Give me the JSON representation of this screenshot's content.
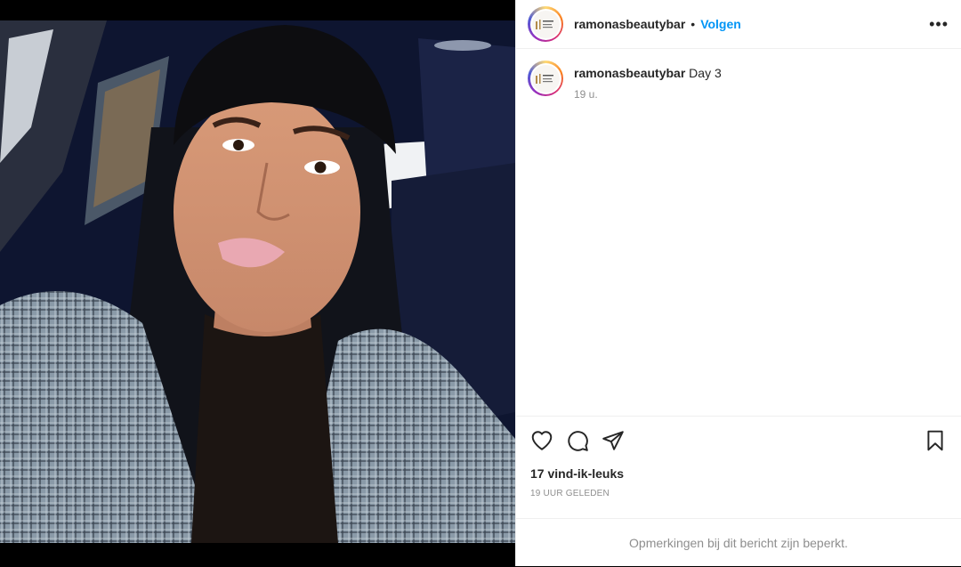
{
  "post": {
    "username": "ramonasbeautybar",
    "separator": "•",
    "follow_label": "Volgen",
    "more_label": "•••",
    "caption_text": "Day 3",
    "caption_time": "19 u.",
    "likes": "17 vind-ik-leuks",
    "date": "19 UUR GELEDEN",
    "comments_notice": "Opmerkingen bij dit bericht zijn beperkt."
  },
  "icons": {
    "like": "heart-icon",
    "comment": "comment-icon",
    "share": "share-icon",
    "save": "bookmark-icon",
    "more": "more-icon"
  },
  "colors": {
    "accent": "#0095f6",
    "text": "#262626",
    "muted": "#8e8e8e",
    "border": "#efefef"
  }
}
